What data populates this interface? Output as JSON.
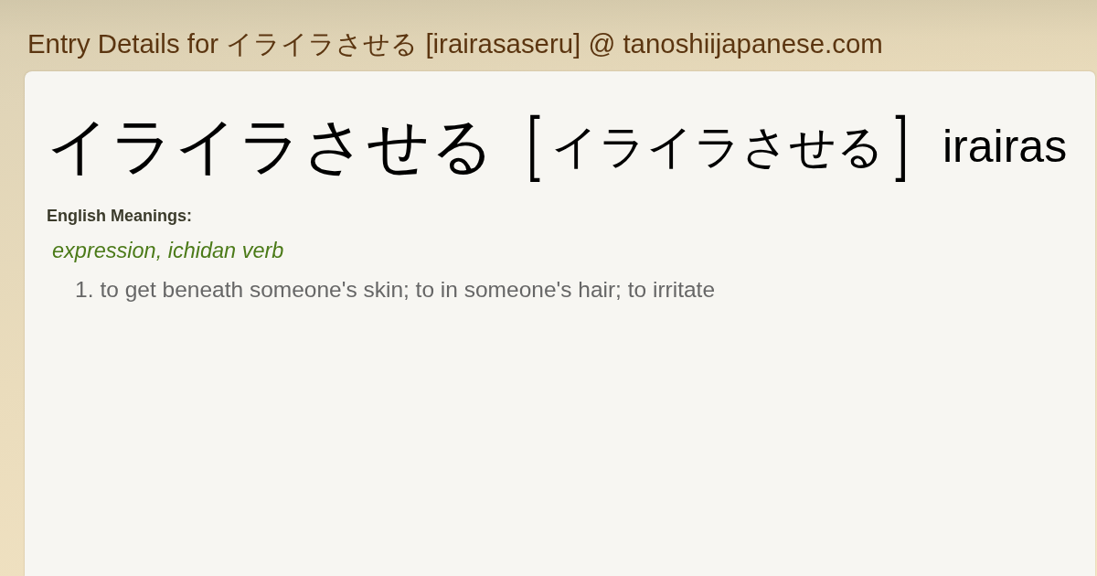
{
  "page_title": "Entry Details for イライラさせる [irairasaseru] @ tanoshiijapanese.com",
  "entry": {
    "word": "イライラさせる",
    "bracket_open": "[",
    "reading": "イライラさせる",
    "bracket_close": "]",
    "romaji": "irairas"
  },
  "meanings_label": "English Meanings:",
  "part_of_speech": "expression, ichidan verb",
  "meanings": [
    {
      "number": "1.",
      "text": "to get beneath someone's skin; to in someone's hair; to irritate"
    }
  ]
}
